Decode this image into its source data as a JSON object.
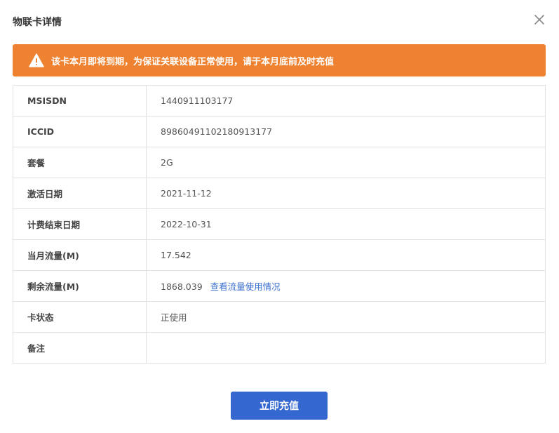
{
  "dialog": {
    "title": "物联卡详情",
    "close_icon": "close-icon"
  },
  "alert": {
    "icon": "warning-icon",
    "text": "该卡本月即将到期，为保证关联设备正常使用，请于本月底前及时充值",
    "color": "#ee8230"
  },
  "details": [
    {
      "label": "MSISDN",
      "value": "1440911103177"
    },
    {
      "label": "ICCID",
      "value": "89860491102180913177"
    },
    {
      "label": "套餐",
      "value": "2G"
    },
    {
      "label": "激活日期",
      "value": "2021-11-12"
    },
    {
      "label": "计费结束日期",
      "value": "2022-10-31"
    },
    {
      "label": "当月流量(M)",
      "value": "17.542"
    },
    {
      "label": "剩余流量(M)",
      "value": "1868.039",
      "link": "查看流量使用情况"
    },
    {
      "label": "卡状态",
      "value": "正使用"
    },
    {
      "label": "备注",
      "value": ""
    }
  ],
  "footer": {
    "recharge_label": "立即充值",
    "button_color": "#3567d0"
  }
}
